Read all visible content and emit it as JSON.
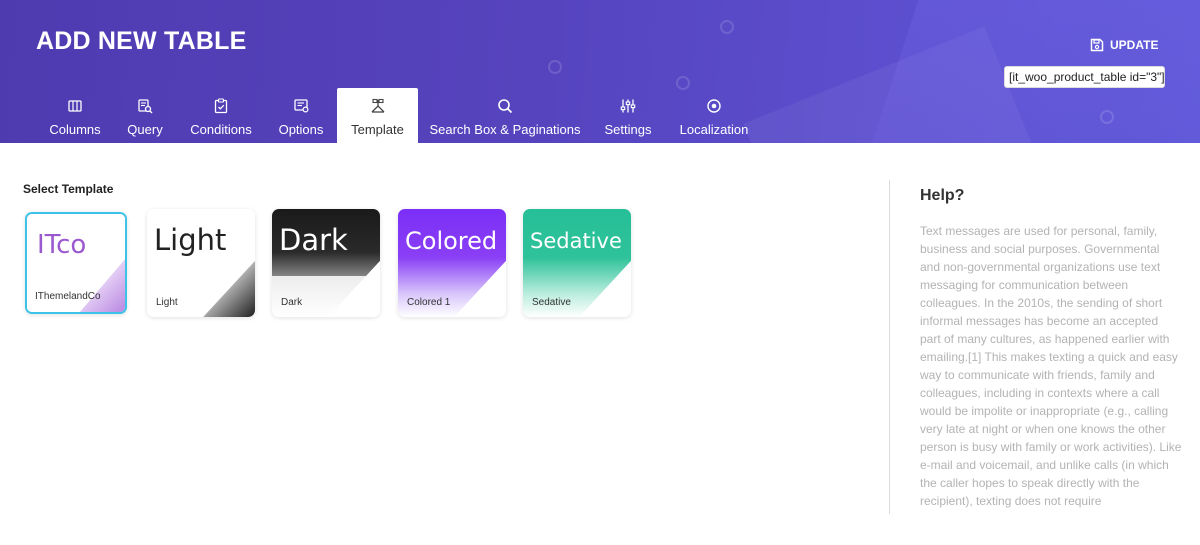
{
  "header": {
    "title": "ADD NEW TABLE",
    "update_label": "UPDATE",
    "shortcode": "[it_woo_product_table id=\"3\"]"
  },
  "tabs": [
    {
      "label": "Columns",
      "icon": "columns-icon"
    },
    {
      "label": "Query",
      "icon": "query-icon"
    },
    {
      "label": "Conditions",
      "icon": "conditions-icon"
    },
    {
      "label": "Options",
      "icon": "options-icon"
    },
    {
      "label": "Template",
      "icon": "template-icon",
      "active": true
    },
    {
      "label": "Search Box & Paginations",
      "icon": "search-icon"
    },
    {
      "label": "Settings",
      "icon": "settings-sliders-icon"
    },
    {
      "label": "Localization",
      "icon": "localization-icon"
    }
  ],
  "main": {
    "section_label": "Select Template",
    "templates": [
      {
        "preview_text": "ITco",
        "name": "IThemelandCo",
        "selected": true
      },
      {
        "preview_text": "Light",
        "name": "Light"
      },
      {
        "preview_text": "Dark",
        "name": "Dark"
      },
      {
        "preview_text": "Colored",
        "name": "Colored 1"
      },
      {
        "preview_text": "Sedative",
        "name": "Sedative"
      }
    ]
  },
  "help": {
    "title": "Help?",
    "text": "Text messages are used for personal, family, business and social purposes. Governmental and non-governmental organizations use text messaging for communication between colleagues. In the 2010s, the sending of short informal messages has become an accepted part of many cultures, as happened earlier with emailing.[1] This makes texting a quick and easy way to communicate with friends, family and colleagues, including in contexts where a call would be impolite or inappropriate (e.g., calling very late at night or when one knows the other person is busy with family or work activities). Like e-mail and voicemail, and unlike calls (in which the caller hopes to speak directly with the recipient), texting does not require"
  },
  "colors": {
    "header_start": "#4f3bb0",
    "header_end": "#5e57d6",
    "selected_border": "#3ec3e8",
    "itco_purple": "#9b59d0",
    "colored_purple": "#7b2ff7",
    "sedative_green": "#2fc29a",
    "help_text": "#b3b3b3"
  }
}
